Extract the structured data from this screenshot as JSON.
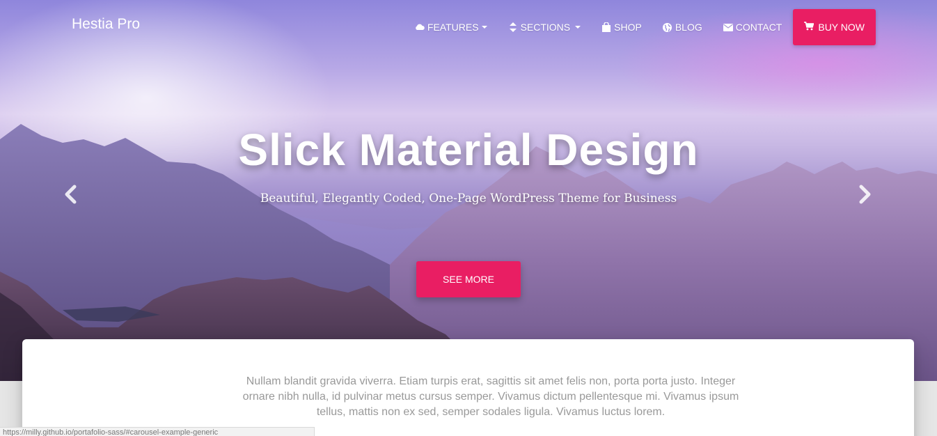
{
  "brand": {
    "name": "Hestia Pro"
  },
  "nav": {
    "items": [
      {
        "label": "FEATURES",
        "icon": "cloud-icon",
        "dropdown": true
      },
      {
        "label": "SECTIONS",
        "icon": "sort-icon",
        "dropdown": true
      },
      {
        "label": "SHOP",
        "icon": "shopping-bag-icon",
        "dropdown": false
      },
      {
        "label": "BLOG",
        "icon": "globe-icon",
        "dropdown": false
      },
      {
        "label": "CONTACT",
        "icon": "envelope-icon",
        "dropdown": false
      }
    ],
    "buy": {
      "label": "BUY NOW",
      "icon": "cart-icon"
    }
  },
  "hero": {
    "title": "Slick Material Design",
    "subtitle": "Beautiful, Elegantly Coded, One-Page WordPress Theme for Business",
    "button": "SEE MORE",
    "prev_icon": "chevron-left-icon",
    "next_icon": "chevron-right-icon"
  },
  "content": {
    "text": "Nullam blandit gravida viverra. Etiam turpis erat, sagittis sit amet felis non, porta porta justo. Integer ornare nibh nulla, id pulvinar metus cursus semper. Vivamus dictum pellentesque mi. Vivamus ipsum tellus, mattis non ex sed, semper sodales ligula. Vivamus luctus lorem."
  },
  "status_bar": {
    "url": "https://milly.github.io/portafolio-sass/#carousel-example-generic"
  },
  "colors": {
    "accent": "#e91e63",
    "text_muted": "#999999"
  }
}
